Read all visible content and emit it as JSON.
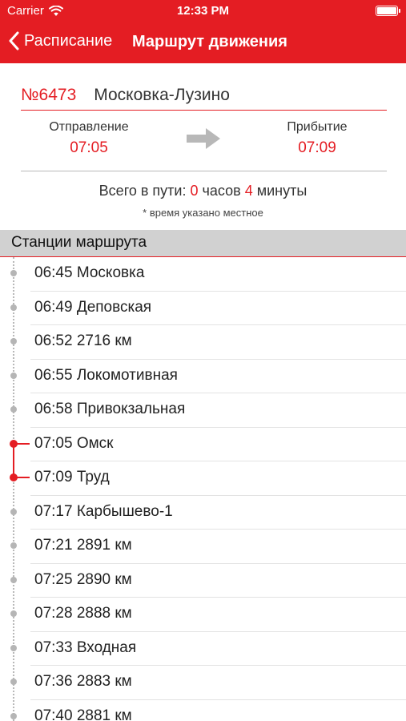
{
  "status_bar": {
    "carrier": "Carrier",
    "time": "12:33 PM"
  },
  "nav": {
    "back_label": "Расписание",
    "title": "Маршрут движения"
  },
  "train": {
    "number": "№6473",
    "route": "Московка-Лузино"
  },
  "departure": {
    "label": "Отправление",
    "time": "07:05"
  },
  "arrival": {
    "label": "Прибытие",
    "time": "07:09"
  },
  "travel_time": {
    "prefix": "Всего в пути:",
    "hours": "0",
    "hours_unit": "часов",
    "minutes": "4",
    "minutes_unit": "минуты"
  },
  "note": "* время указано местное",
  "section_title": "Станции маршрута",
  "colors": {
    "accent": "#e41d23",
    "section_bg": "#d1d1d1",
    "dot": "#b5b5b5"
  },
  "stations": [
    {
      "time": "06:45",
      "name": "Московка",
      "active": false
    },
    {
      "time": "06:49",
      "name": "Деповская",
      "active": false
    },
    {
      "time": "06:52",
      "name": "2716 км",
      "active": false
    },
    {
      "time": "06:55",
      "name": "Локомотивная",
      "active": false
    },
    {
      "time": "06:58",
      "name": "Привокзальная",
      "active": false
    },
    {
      "time": "07:05",
      "name": "Омск",
      "active": true
    },
    {
      "time": "07:09",
      "name": "Труд",
      "active": true
    },
    {
      "time": "07:17",
      "name": "Карбышево-1",
      "active": false
    },
    {
      "time": "07:21",
      "name": "2891 км",
      "active": false
    },
    {
      "time": "07:25",
      "name": "2890 км",
      "active": false
    },
    {
      "time": "07:28",
      "name": "2888 км",
      "active": false
    },
    {
      "time": "07:33",
      "name": "Входная",
      "active": false
    },
    {
      "time": "07:36",
      "name": "2883 км",
      "active": false
    },
    {
      "time": "07:40",
      "name": "2881 км",
      "active": false
    }
  ]
}
